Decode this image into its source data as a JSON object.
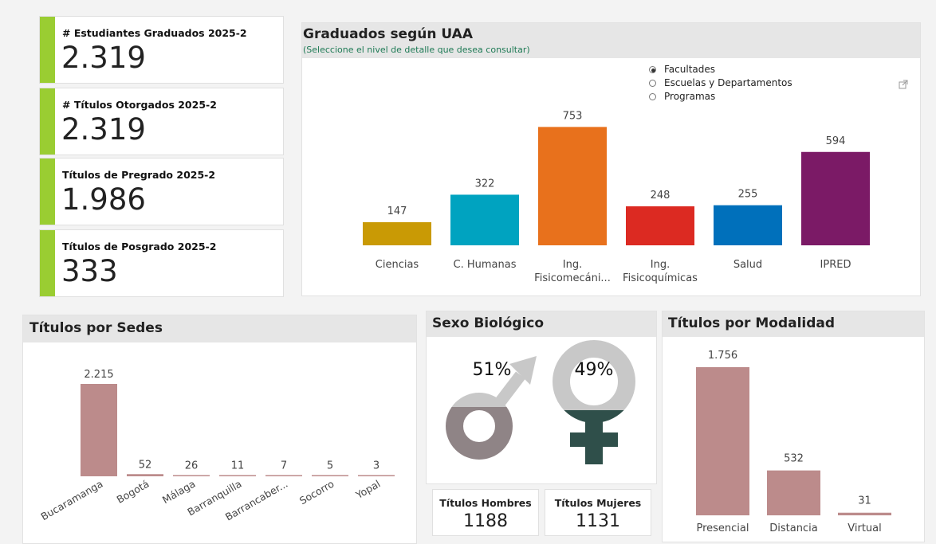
{
  "kpis": [
    {
      "label": "# Estudiantes Graduados 2025-2",
      "value": "2.319"
    },
    {
      "label": "# Títulos Otorgados 2025-2",
      "value": "2.319"
    },
    {
      "label": "Títulos de Pregrado 2025-2",
      "value": "1.986"
    },
    {
      "label": "Títulos de Posgrado 2025-2",
      "value": "333"
    }
  ],
  "uaa": {
    "title": "Graduados según UAA",
    "subtitle": "(Seleccione el nivel de detalle que desea consultar)",
    "options": [
      "Facultades",
      "Escuelas y Departamentos",
      "Programas"
    ],
    "selected": "Facultades",
    "expand_icon": "expand-icon"
  },
  "sedes": {
    "title": "Títulos por Sedes"
  },
  "sexo": {
    "title": "Sexo Biológico",
    "male_pct": "51%",
    "female_pct": "49%",
    "male_icon": "male-symbol-icon",
    "female_icon": "female-symbol-icon",
    "hombres_label": "Títulos Hombres",
    "hombres_value": "1188",
    "mujeres_label": "Títulos Mujeres",
    "mujeres_value": "1131",
    "colors": {
      "male_fill": "#8f8486",
      "female_fill": "#2f4f4a",
      "empty": "#c8c8c8"
    }
  },
  "modalidad": {
    "title": "Títulos por Modalidad"
  },
  "chart_data": [
    {
      "type": "bar",
      "title": "Graduados según UAA",
      "categories": [
        "Ciencias",
        "C. Humanas",
        "Ing. Fisicomecáni...",
        "Ing. Fisicoquímicas",
        "Salud",
        "IPRED"
      ],
      "category_lines": [
        [
          "Ciencias"
        ],
        [
          "C. Humanas"
        ],
        [
          "Ing.",
          "Fisicomecáni..."
        ],
        [
          "Ing.",
          "Fisicoquímicas"
        ],
        [
          "Salud"
        ],
        [
          "IPRED"
        ]
      ],
      "values": [
        147,
        322,
        753,
        248,
        255,
        594
      ],
      "labels": [
        "147",
        "322",
        "753",
        "248",
        "255",
        "594"
      ],
      "colors": [
        "#c99a05",
        "#00a3c0",
        "#e8711c",
        "#dc2a22",
        "#0070bb",
        "#7b1a66"
      ],
      "ylim": [
        0,
        760
      ],
      "grid": false
    },
    {
      "type": "bar",
      "title": "Títulos por Sedes",
      "categories": [
        "Bucaramanga",
        "Bogotá",
        "Málaga",
        "Barranquilla",
        "Barrancaber...",
        "Socorro",
        "Yopal"
      ],
      "values": [
        2215,
        52,
        26,
        11,
        7,
        5,
        3
      ],
      "labels": [
        "2.215",
        "52",
        "26",
        "11",
        "7",
        "5",
        "3"
      ],
      "color": "#bc8b8b",
      "ylim": [
        0,
        2215
      ],
      "grid": false
    },
    {
      "type": "bar",
      "title": "Títulos por Modalidad",
      "categories": [
        "Presencial",
        "Distancia",
        "Virtual"
      ],
      "values": [
        1756,
        532,
        31
      ],
      "labels": [
        "1.756",
        "532",
        "31"
      ],
      "color": "#bc8b8b",
      "ylim": [
        0,
        1756
      ],
      "grid": false
    }
  ]
}
